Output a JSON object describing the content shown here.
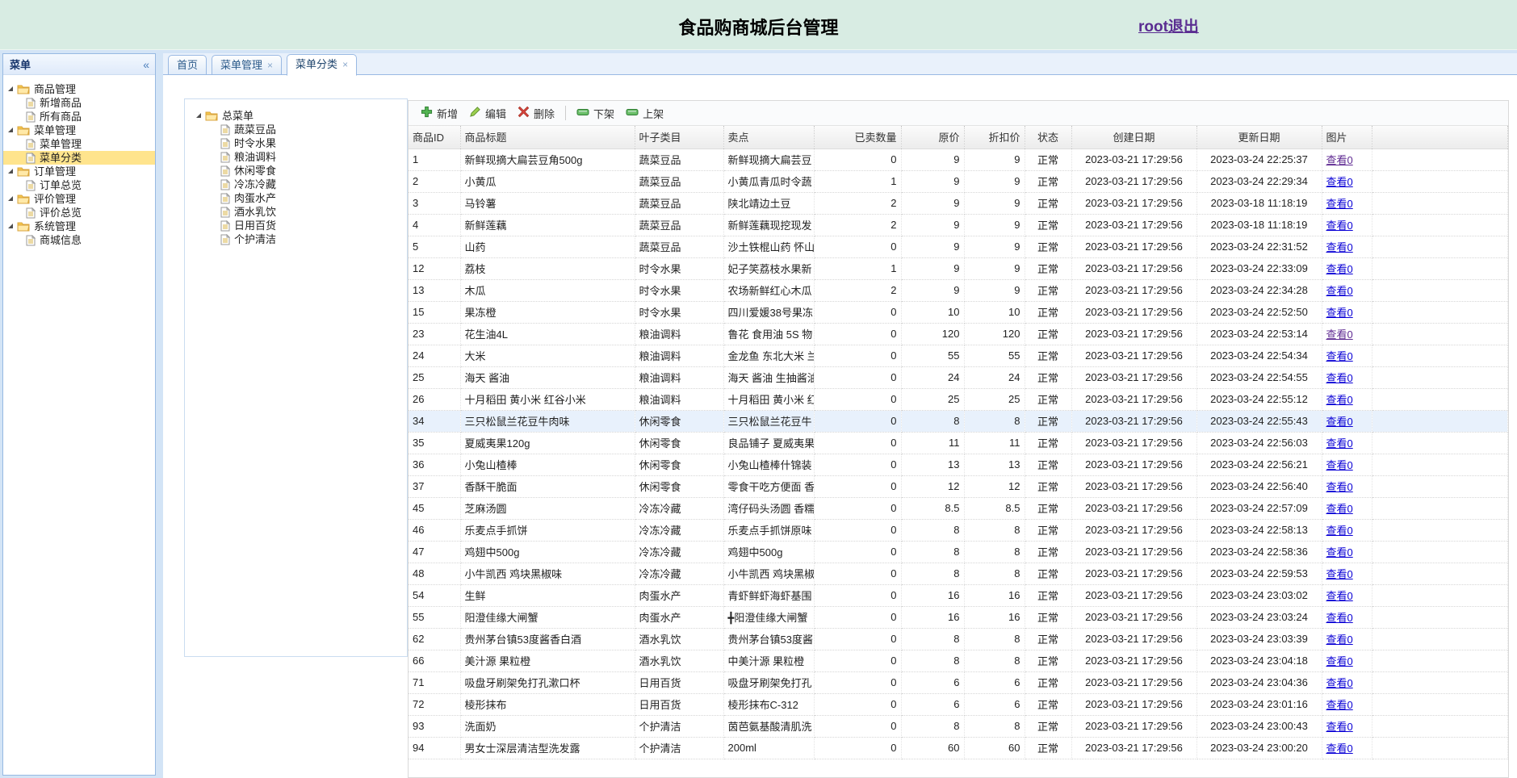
{
  "header": {
    "title": "食品购商城后台管理",
    "logout": "root退出"
  },
  "ui": {
    "collapse": "«",
    "tab_close": "×"
  },
  "colors": {
    "header_bg": "#d8ece3",
    "tree_selected_bg": "#ffe48d",
    "row_selected_bg": "#e8f1fc",
    "link_blue": "#0a00d6",
    "link_visited": "#5f2a92",
    "logout_purple": "#5a2d91",
    "panel_border": "#97b9e2"
  },
  "sidebar": {
    "title": "菜单",
    "tree": [
      {
        "label": "商品管理",
        "children": [
          {
            "label": "新增商品"
          },
          {
            "label": "所有商品"
          }
        ]
      },
      {
        "label": "菜单管理",
        "children": [
          {
            "label": "菜单管理"
          },
          {
            "label": "菜单分类",
            "selected": true
          }
        ]
      },
      {
        "label": "订单管理",
        "children": [
          {
            "label": "订单总览"
          }
        ]
      },
      {
        "label": "评价管理",
        "children": [
          {
            "label": "评价总览"
          }
        ]
      },
      {
        "label": "系统管理",
        "children": [
          {
            "label": "商城信息"
          }
        ]
      }
    ]
  },
  "tabs": [
    {
      "label": "首页",
      "closable": false,
      "active": false
    },
    {
      "label": "菜单管理",
      "closable": true,
      "active": false
    },
    {
      "label": "菜单分类",
      "closable": true,
      "active": true
    }
  ],
  "category_tree": {
    "root": "总菜单",
    "items": [
      "蔬菜豆品",
      "时令水果",
      "粮油调料",
      "休闲零食",
      "冷冻冷藏",
      "肉蛋水产",
      "酒水乳饮",
      "日用百货",
      "个护清洁"
    ]
  },
  "toolbar": {
    "buttons": [
      {
        "id": "add",
        "label": "新增"
      },
      {
        "id": "edit",
        "label": "编辑"
      },
      {
        "id": "delete",
        "label": "删除"
      },
      {
        "sep": true
      },
      {
        "id": "off",
        "label": "下架"
      },
      {
        "id": "on",
        "label": "上架"
      }
    ]
  },
  "table": {
    "columns": [
      "商品ID",
      "商品标题",
      "叶子类目",
      "卖点",
      "已卖数量",
      "原价",
      "折扣价",
      "状态",
      "创建日期",
      "更新日期",
      "图片"
    ],
    "view_label": "查看0",
    "rows": [
      {
        "id": 1,
        "title": "新鲜现摘大扁芸豆角500g",
        "category": "蔬菜豆品",
        "sell": "新鲜现摘大扁芸豆",
        "sold": 0,
        "price": 9,
        "discount": 9,
        "status": "正常",
        "created": "2023-03-21 17:29:56",
        "updated": "2023-03-24 22:25:37",
        "visited": true,
        "selected": false
      },
      {
        "id": 2,
        "title": "小黄瓜",
        "category": "蔬菜豆品",
        "sell": "小黄瓜青瓜时令蔬",
        "sold": 1,
        "price": 9,
        "discount": 9,
        "status": "正常",
        "created": "2023-03-21 17:29:56",
        "updated": "2023-03-24 22:29:34",
        "visited": false,
        "selected": false
      },
      {
        "id": 3,
        "title": "马铃薯",
        "category": "蔬菜豆品",
        "sell": "陕北靖边土豆",
        "sold": 2,
        "price": 9,
        "discount": 9,
        "status": "正常",
        "created": "2023-03-21 17:29:56",
        "updated": "2023-03-18 11:18:19",
        "visited": false,
        "selected": false
      },
      {
        "id": 4,
        "title": "新鲜莲藕",
        "category": "蔬菜豆品",
        "sell": "新鲜莲藕现挖现发",
        "sold": 2,
        "price": 9,
        "discount": 9,
        "status": "正常",
        "created": "2023-03-21 17:29:56",
        "updated": "2023-03-18 11:18:19",
        "visited": false,
        "selected": false
      },
      {
        "id": 5,
        "title": "山药",
        "category": "蔬菜豆品",
        "sell": "沙土铁棍山药 怀山",
        "sold": 0,
        "price": 9,
        "discount": 9,
        "status": "正常",
        "created": "2023-03-21 17:29:56",
        "updated": "2023-03-24 22:31:52",
        "visited": false,
        "selected": false
      },
      {
        "id": 12,
        "title": "荔枝",
        "category": "时令水果",
        "sell": "妃子笑荔枝水果新",
        "sold": 1,
        "price": 9,
        "discount": 9,
        "status": "正常",
        "created": "2023-03-21 17:29:56",
        "updated": "2023-03-24 22:33:09",
        "visited": false,
        "selected": false
      },
      {
        "id": 13,
        "title": "木瓜",
        "category": "时令水果",
        "sell": "农场新鲜红心木瓜",
        "sold": 2,
        "price": 9,
        "discount": 9,
        "status": "正常",
        "created": "2023-03-21 17:29:56",
        "updated": "2023-03-24 22:34:28",
        "visited": false,
        "selected": false
      },
      {
        "id": 15,
        "title": "果冻橙",
        "category": "时令水果",
        "sell": "四川爱媛38号果冻",
        "sold": 0,
        "price": 10,
        "discount": 10,
        "status": "正常",
        "created": "2023-03-21 17:29:56",
        "updated": "2023-03-24 22:52:50",
        "visited": false,
        "selected": false
      },
      {
        "id": 23,
        "title": "花生油4L",
        "category": "粮油调料",
        "sell": "鲁花 食用油 5S 物",
        "sold": 0,
        "price": 120,
        "discount": 120,
        "status": "正常",
        "created": "2023-03-21 17:29:56",
        "updated": "2023-03-24 22:53:14",
        "visited": true,
        "selected": false
      },
      {
        "id": 24,
        "title": "大米",
        "category": "粮油调料",
        "sell": "金龙鱼 东北大米 兰",
        "sold": 0,
        "price": 55,
        "discount": 55,
        "status": "正常",
        "created": "2023-03-21 17:29:56",
        "updated": "2023-03-24 22:54:34",
        "visited": false,
        "selected": false
      },
      {
        "id": 25,
        "title": "海天 酱油",
        "category": "粮油调料",
        "sell": "海天 酱油 生抽酱油",
        "sold": 0,
        "price": 24,
        "discount": 24,
        "status": "正常",
        "created": "2023-03-21 17:29:56",
        "updated": "2023-03-24 22:54:55",
        "visited": false,
        "selected": false
      },
      {
        "id": 26,
        "title": "十月稻田 黄小米 红谷小米",
        "category": "粮油调料",
        "sell": "十月稻田 黄小米 红",
        "sold": 0,
        "price": 25,
        "discount": 25,
        "status": "正常",
        "created": "2023-03-21 17:29:56",
        "updated": "2023-03-24 22:55:12",
        "visited": false,
        "selected": false
      },
      {
        "id": 34,
        "title": "三只松鼠兰花豆牛肉味",
        "category": "休闲零食",
        "sell": "三只松鼠兰花豆牛",
        "sold": 0,
        "price": 8,
        "discount": 8,
        "status": "正常",
        "created": "2023-03-21 17:29:56",
        "updated": "2023-03-24 22:55:43",
        "visited": false,
        "selected": true
      },
      {
        "id": 35,
        "title": "夏威夷果120g",
        "category": "休闲零食",
        "sell": "良品铺子 夏威夷果",
        "sold": 0,
        "price": 11,
        "discount": 11,
        "status": "正常",
        "created": "2023-03-21 17:29:56",
        "updated": "2023-03-24 22:56:03",
        "visited": false,
        "selected": false
      },
      {
        "id": 36,
        "title": "小兔山楂棒",
        "category": "休闲零食",
        "sell": "小兔山楂棒什锦装",
        "sold": 0,
        "price": 13,
        "discount": 13,
        "status": "正常",
        "created": "2023-03-21 17:29:56",
        "updated": "2023-03-24 22:56:21",
        "visited": false,
        "selected": false
      },
      {
        "id": 37,
        "title": "香酥干脆面",
        "category": "休闲零食",
        "sell": "零食干吃方便面 香",
        "sold": 0,
        "price": 12,
        "discount": 12,
        "status": "正常",
        "created": "2023-03-21 17:29:56",
        "updated": "2023-03-24 22:56:40",
        "visited": false,
        "selected": false
      },
      {
        "id": 45,
        "title": "芝麻汤圆",
        "category": "冷冻冷藏",
        "sell": "湾仔码头汤圆 香糯",
        "sold": 0,
        "price": 8.5,
        "discount": 8.5,
        "status": "正常",
        "created": "2023-03-21 17:29:56",
        "updated": "2023-03-24 22:57:09",
        "visited": false,
        "selected": false
      },
      {
        "id": 46,
        "title": "乐麦点手抓饼",
        "category": "冷冻冷藏",
        "sell": "乐麦点手抓饼原味",
        "sold": 0,
        "price": 8,
        "discount": 8,
        "status": "正常",
        "created": "2023-03-21 17:29:56",
        "updated": "2023-03-24 22:58:13",
        "visited": false,
        "selected": false
      },
      {
        "id": 47,
        "title": "鸡翅中500g",
        "category": "冷冻冷藏",
        "sell": "鸡翅中500g",
        "sold": 0,
        "price": 8,
        "discount": 8,
        "status": "正常",
        "created": "2023-03-21 17:29:56",
        "updated": "2023-03-24 22:58:36",
        "visited": false,
        "selected": false
      },
      {
        "id": 48,
        "title": "小牛凯西 鸡块黑椒味",
        "category": "冷冻冷藏",
        "sell": "小牛凯西 鸡块黑椒",
        "sold": 0,
        "price": 8,
        "discount": 8,
        "status": "正常",
        "created": "2023-03-21 17:29:56",
        "updated": "2023-03-24 22:59:53",
        "visited": false,
        "selected": false
      },
      {
        "id": 54,
        "title": "生鲜",
        "category": "肉蛋水产",
        "sell": "青虾鲜虾海虾基围",
        "sold": 0,
        "price": 16,
        "discount": 16,
        "status": "正常",
        "created": "2023-03-21 17:29:56",
        "updated": "2023-03-24 23:03:02",
        "visited": false,
        "selected": false
      },
      {
        "id": 55,
        "title": "阳澄佳缘大闸蟹",
        "category": "肉蛋水产",
        "sell": "╋阳澄佳缘大闸蟹",
        "sold": 0,
        "price": 16,
        "discount": 16,
        "status": "正常",
        "created": "2023-03-21 17:29:56",
        "updated": "2023-03-24 23:03:24",
        "visited": false,
        "selected": false
      },
      {
        "id": 62,
        "title": "贵州茅台镇53度酱香白酒",
        "category": "酒水乳饮",
        "sell": "贵州茅台镇53度酱",
        "sold": 0,
        "price": 8,
        "discount": 8,
        "status": "正常",
        "created": "2023-03-21 17:29:56",
        "updated": "2023-03-24 23:03:39",
        "visited": false,
        "selected": false
      },
      {
        "id": 66,
        "title": "美汁源 果粒橙",
        "category": "酒水乳饮",
        "sell": "中美汁源 果粒橙",
        "sold": 0,
        "price": 8,
        "discount": 8,
        "status": "正常",
        "created": "2023-03-21 17:29:56",
        "updated": "2023-03-24 23:04:18",
        "visited": false,
        "selected": false
      },
      {
        "id": 71,
        "title": "吸盘牙刷架免打孔漱口杯",
        "category": "日用百货",
        "sell": "吸盘牙刷架免打孔",
        "sold": 0,
        "price": 6,
        "discount": 6,
        "status": "正常",
        "created": "2023-03-21 17:29:56",
        "updated": "2023-03-24 23:04:36",
        "visited": false,
        "selected": false
      },
      {
        "id": 72,
        "title": "棱形抹布",
        "category": "日用百货",
        "sell": "棱形抹布C-312",
        "sold": 0,
        "price": 6,
        "discount": 6,
        "status": "正常",
        "created": "2023-03-21 17:29:56",
        "updated": "2023-03-24 23:01:16",
        "visited": false,
        "selected": false
      },
      {
        "id": 93,
        "title": "洗面奶",
        "category": "个护清洁",
        "sell": "茵芭氨基酸清肌洗",
        "sold": 0,
        "price": 8,
        "discount": 8,
        "status": "正常",
        "created": "2023-03-21 17:29:56",
        "updated": "2023-03-24 23:00:43",
        "visited": false,
        "selected": false
      },
      {
        "id": 94,
        "title": "男女士深层清洁型洗发露",
        "category": "个护清洁",
        "sell": "200ml",
        "sold": 0,
        "price": 60,
        "discount": 60,
        "status": "正常",
        "created": "2023-03-21 17:29:56",
        "updated": "2023-03-24 23:00:20",
        "visited": false,
        "selected": false
      }
    ]
  }
}
